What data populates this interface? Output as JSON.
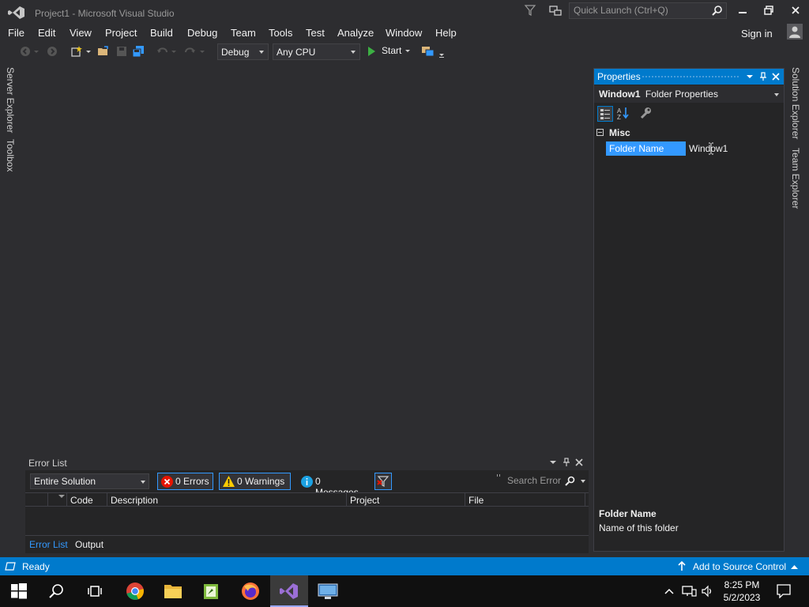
{
  "window": {
    "title": "Project1 - Microsoft Visual Studio",
    "quick_launch_placeholder": "Quick Launch (Ctrl+Q)",
    "sign_in": "Sign in"
  },
  "menu": [
    "File",
    "Edit",
    "View",
    "Project",
    "Build",
    "Debug",
    "Team",
    "Tools",
    "Test",
    "Analyze",
    "Window",
    "Help"
  ],
  "toolbar": {
    "configuration": "Debug",
    "platform": "Any CPU",
    "start_label": "Start"
  },
  "left_tabs": [
    "Server Explorer",
    "Toolbox"
  ],
  "right_tabs": [
    "Solution Explorer",
    "Team Explorer"
  ],
  "properties": {
    "title": "Properties",
    "object_name": "Window1",
    "object_type": "Folder Properties",
    "category": "Misc",
    "property_name": "Folder Name",
    "property_value": "Window1",
    "description_title": "Folder Name",
    "description_text": "Name of this folder"
  },
  "error_list": {
    "title": "Error List",
    "scope": "Entire Solution",
    "errors_label": "0 Errors",
    "warnings_label": "0 Warnings",
    "messages_label": "0 Messages",
    "search_placeholder": "Search Error",
    "columns": [
      "Code",
      "Description",
      "Project",
      "File"
    ],
    "tabs": [
      "Error List",
      "Output"
    ]
  },
  "status": {
    "ready": "Ready",
    "source_control": "Add to Source Control"
  },
  "taskbar": {
    "time": "8:25 PM",
    "date": "5/2/2023"
  },
  "colors": {
    "accent": "#007acc",
    "background": "#2d2d30",
    "panel": "#252526",
    "selection": "#3399ff"
  }
}
